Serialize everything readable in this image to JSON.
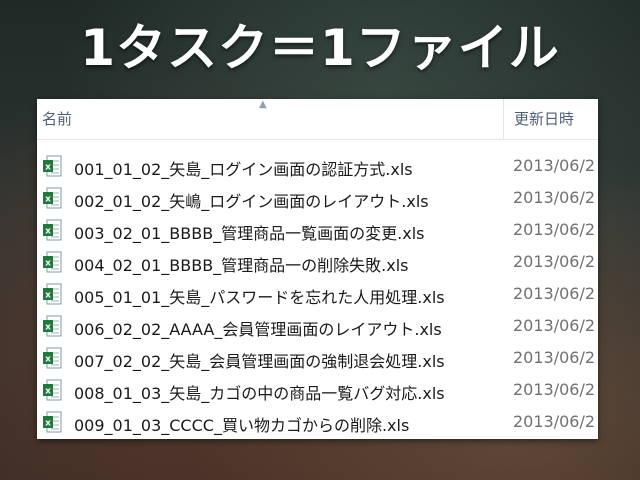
{
  "slide": {
    "title": "1タスク＝1ファイル"
  },
  "explorer": {
    "columns": {
      "name": "名前",
      "modified": "更新日時"
    },
    "files": [
      {
        "name": "001_01_02_矢島_ログイン画面の認証方式.xls",
        "modified": "2013/06/2",
        "icon": "excel-file-icon"
      },
      {
        "name": "002_01_02_矢嶋_ログイン画面のレイアウト.xls",
        "modified": "2013/06/2",
        "icon": "excel-file-icon"
      },
      {
        "name": "003_02_01_BBBB_管理商品一覧画面の変更.xls",
        "modified": "2013/06/2",
        "icon": "excel-file-icon"
      },
      {
        "name": "004_02_01_BBBB_管理商品一の削除失敗.xls",
        "modified": "2013/06/2",
        "icon": "excel-file-icon"
      },
      {
        "name": "005_01_01_矢島_パスワードを忘れた人用処理.xls",
        "modified": "2013/06/2",
        "icon": "excel-file-icon"
      },
      {
        "name": "006_02_02_AAAA_会員管理画面のレイアウト.xls",
        "modified": "2013/06/2",
        "icon": "excel-file-icon"
      },
      {
        "name": "007_02_02_矢島_会員管理画面の強制退会処理.xls",
        "modified": "2013/06/2",
        "icon": "excel-file-icon"
      },
      {
        "name": "008_01_03_矢島_カゴの中の商品一覧バグ対応.xls",
        "modified": "2013/06/2",
        "icon": "excel-file-icon"
      },
      {
        "name": "009_01_03_CCCC_買い物カゴからの削除.xls",
        "modified": "2013/06/2",
        "icon": "excel-file-icon"
      }
    ]
  },
  "colors": {
    "excel_green": "#1e7a3c",
    "header_text": "#4c607a",
    "date_text": "#707070"
  }
}
